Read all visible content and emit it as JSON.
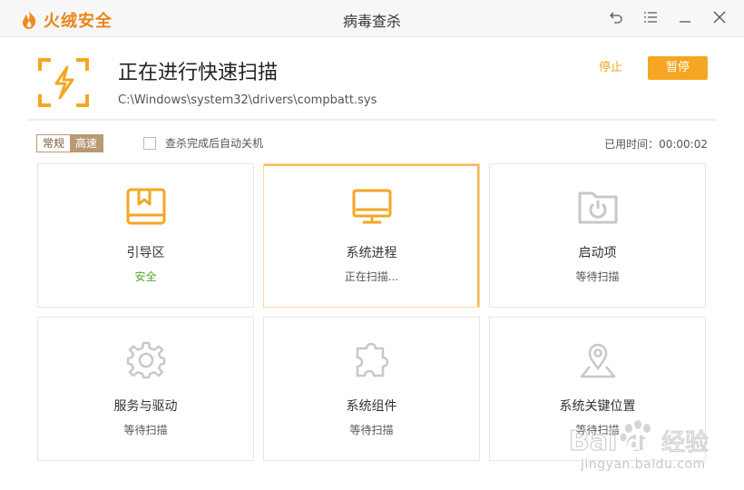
{
  "app": {
    "name": "火绒安全",
    "window_title": "病毒查杀"
  },
  "scan": {
    "title": "正在进行快速扫描",
    "path": "C:\\Windows\\system32\\drivers\\compbatt.sys",
    "stop_label": "停止",
    "pause_label": "暂停"
  },
  "options": {
    "mode_normal": "常规",
    "mode_fast": "高速",
    "shutdown_label": "查杀完成后自动关机",
    "elapsed_label": "已用时间：00:00:02"
  },
  "cards": [
    {
      "name": "引导区",
      "status": "安全",
      "icon": "boot-sector-icon"
    },
    {
      "name": "系统进程",
      "status": "正在扫描...",
      "icon": "monitor-icon"
    },
    {
      "name": "启动项",
      "status": "等待扫描",
      "icon": "startup-folder-icon"
    },
    {
      "name": "服务与驱动",
      "status": "等待扫描",
      "icon": "gear-icon"
    },
    {
      "name": "系统组件",
      "status": "等待扫描",
      "icon": "puzzle-icon"
    },
    {
      "name": "系统关键位置",
      "status": "等待扫描",
      "icon": "location-pin-icon"
    }
  ],
  "watermark": {
    "text": "jingyan.baidu.com",
    "logo_text": "Bai du 经验"
  },
  "colors": {
    "accent": "#f5a623",
    "safe": "#52a52e",
    "inactive_icon": "#c8c8c8"
  }
}
